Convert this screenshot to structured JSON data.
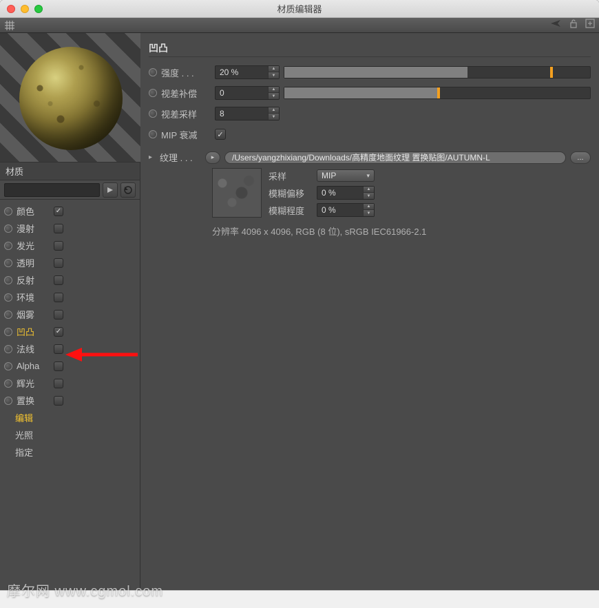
{
  "window": {
    "title": "材质编辑器"
  },
  "sidebar": {
    "header": "材质",
    "channels": [
      {
        "label": "颜色",
        "checked": true,
        "selected": false
      },
      {
        "label": "漫射",
        "checked": false,
        "selected": false
      },
      {
        "label": "发光",
        "checked": false,
        "selected": false
      },
      {
        "label": "透明",
        "checked": false,
        "selected": false
      },
      {
        "label": "反射",
        "checked": false,
        "selected": false
      },
      {
        "label": "环境",
        "checked": false,
        "selected": false
      },
      {
        "label": "烟雾",
        "checked": false,
        "selected": false
      },
      {
        "label": "凹凸",
        "checked": true,
        "selected": true
      },
      {
        "label": "法线",
        "checked": false,
        "selected": false
      },
      {
        "label": "Alpha",
        "checked": false,
        "selected": false
      },
      {
        "label": "辉光",
        "checked": false,
        "selected": false
      },
      {
        "label": "置换",
        "checked": false,
        "selected": false
      }
    ],
    "extra": [
      {
        "label": "编辑",
        "highlight": true
      },
      {
        "label": "光照",
        "highlight": false
      },
      {
        "label": "指定",
        "highlight": false
      }
    ]
  },
  "panel": {
    "title": "凹凸",
    "strength": {
      "label": "强度 . . .",
      "value": "20 %",
      "fill_pct": 60,
      "mark_pct": 87
    },
    "parallax_offset": {
      "label": "视差补偿",
      "value": "0",
      "fill_pct": 50,
      "mark_pct": 50
    },
    "parallax_samples": {
      "label": "视差采样",
      "value": "8"
    },
    "mip_falloff": {
      "label": "MIP 衰减",
      "checked": true
    },
    "texture": {
      "label": "纹理 . . .",
      "path": "/Users/yangzhixiang/Downloads/高精度地面纹理 置换贴图/AUTUMN-L",
      "sampling_label": "采样",
      "sampling_value": "MIP",
      "blur_offset_label": "模糊偏移",
      "blur_offset_value": "0 %",
      "blur_scale_label": "模糊程度",
      "blur_scale_value": "0 %",
      "info": "分辨率 4096 x 4096, RGB (8 位), sRGB IEC61966-2.1"
    }
  },
  "watermark": "摩尔网 www.cgmol.com"
}
